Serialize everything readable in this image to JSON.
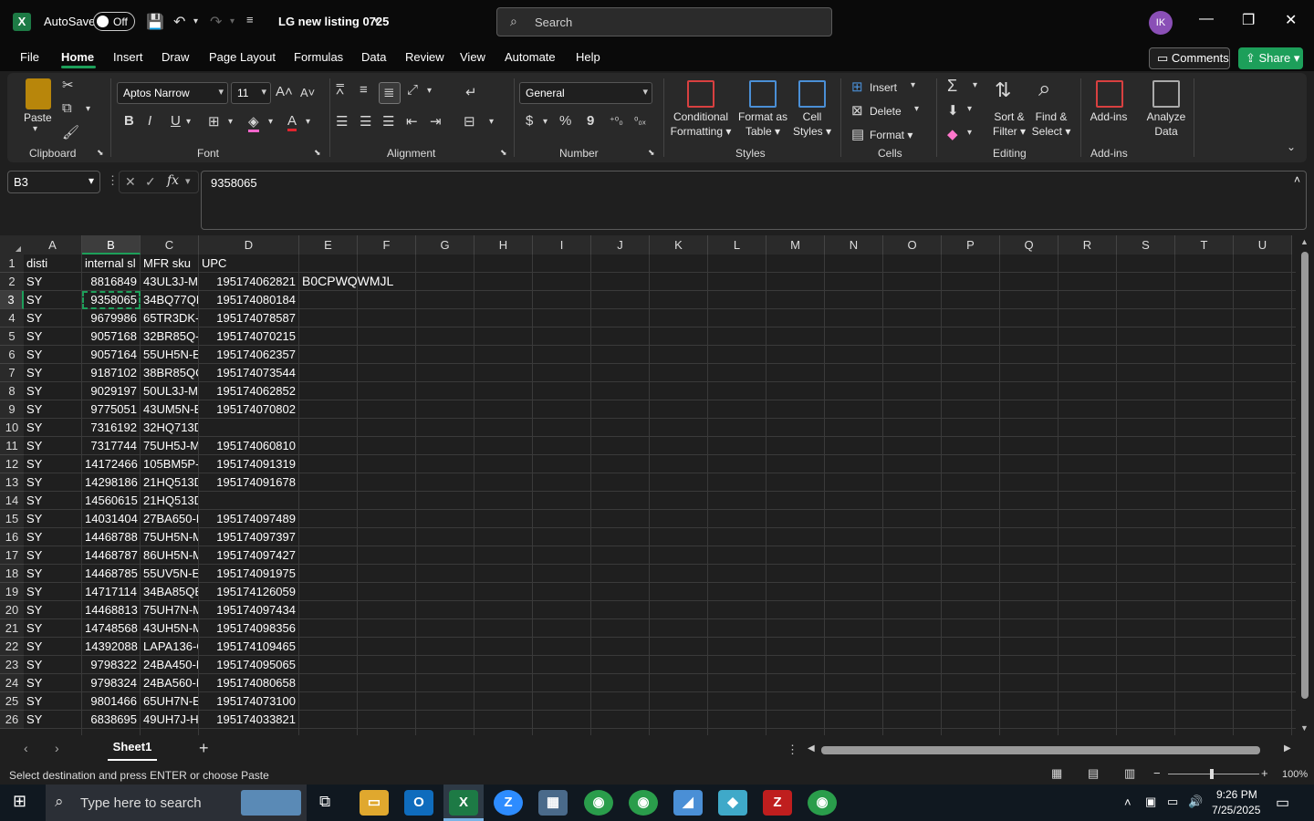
{
  "title_bar": {
    "autosave_label": "AutoSave",
    "autosave_state": "Off",
    "file_name": "LG new listing 0725",
    "search_placeholder": "Search",
    "user_initials": "IK"
  },
  "menu": {
    "items": [
      "File",
      "Home",
      "Insert",
      "Draw",
      "Page Layout",
      "Formulas",
      "Data",
      "Review",
      "View",
      "Automate",
      "Help"
    ],
    "active": "Home",
    "comments_label": "Comments",
    "share_label": "Share"
  },
  "ribbon": {
    "clipboard": {
      "paste": "Paste",
      "label": "Clipboard"
    },
    "font": {
      "name": "Aptos Narrow",
      "size": "11",
      "label": "Font",
      "bold": "B",
      "italic": "I",
      "underline": "U"
    },
    "alignment": {
      "label": "Alignment"
    },
    "number": {
      "format": "General",
      "label": "Number",
      "currency": "$",
      "percent": "%",
      "comma": "9"
    },
    "styles": {
      "conditional_1": "Conditional",
      "conditional_2": "Formatting",
      "format_table_1": "Format as",
      "format_table_2": "Table",
      "cell_styles_1": "Cell",
      "cell_styles_2": "Styles",
      "label": "Styles"
    },
    "cells": {
      "insert": "Insert",
      "delete": "Delete",
      "format": "Format",
      "label": "Cells"
    },
    "editing": {
      "sort_1": "Sort &",
      "sort_2": "Filter",
      "find_1": "Find &",
      "find_2": "Select",
      "label": "Editing"
    },
    "addins": {
      "addins": "Add-ins",
      "analyze_1": "Analyze",
      "analyze_2": "Data",
      "label": "Add-ins"
    }
  },
  "formula_bar": {
    "name_box": "B3",
    "formula": "9358065"
  },
  "sheet": {
    "columns": [
      "A",
      "B",
      "C",
      "D",
      "E",
      "F",
      "G",
      "H",
      "I",
      "J",
      "K",
      "L",
      "M",
      "N",
      "O",
      "P",
      "Q",
      "R",
      "S",
      "T",
      "U"
    ],
    "selected_column": "B",
    "selected_row": "3",
    "headers": {
      "A": "disti",
      "B": "internal sl",
      "C": "MFR sku",
      "D": "UPC"
    },
    "E2": "B0CPWQWMJL",
    "rows": [
      {
        "num": "2",
        "A": "SY",
        "B": "8816849",
        "C": "43UL3J-M",
        "D": "195174062821"
      },
      {
        "num": "3",
        "A": "SY",
        "B": "9358065",
        "C": "34BQ77QE",
        "D": "195174080184"
      },
      {
        "num": "4",
        "A": "SY",
        "B": "9679986",
        "C": "65TR3DK-E",
        "D": "195174078587"
      },
      {
        "num": "5",
        "A": "SY",
        "B": "9057168",
        "C": "32BR85Q-I",
        "D": "195174070215"
      },
      {
        "num": "6",
        "A": "SY",
        "B": "9057164",
        "C": "55UH5N-E",
        "D": "195174062357"
      },
      {
        "num": "7",
        "A": "SY",
        "B": "9187102",
        "C": "38BR85QC",
        "D": "195174073544"
      },
      {
        "num": "8",
        "A": "SY",
        "B": "9029197",
        "C": "50UL3J-M",
        "D": "195174062852"
      },
      {
        "num": "9",
        "A": "SY",
        "B": "9775051",
        "C": "43UM5N-E",
        "D": "195174070802"
      },
      {
        "num": "10",
        "A": "SY",
        "B": "7316192",
        "C": "32HQ713D",
        "D": ""
      },
      {
        "num": "11",
        "A": "SY",
        "B": "7317744",
        "C": "75UH5J-M",
        "D": "195174060810"
      },
      {
        "num": "12",
        "A": "SY",
        "B": "14172466",
        "C": "105BM5P-",
        "D": "195174091319"
      },
      {
        "num": "13",
        "A": "SY",
        "B": "14298186",
        "C": "21HQ513D",
        "D": "195174091678"
      },
      {
        "num": "14",
        "A": "SY",
        "B": "14560615",
        "C": "21HQ513D",
        "D": ""
      },
      {
        "num": "15",
        "A": "SY",
        "B": "14031404",
        "C": "27BA650-E",
        "D": "195174097489"
      },
      {
        "num": "16",
        "A": "SY",
        "B": "14468788",
        "C": "75UH5N-M",
        "D": "195174097397"
      },
      {
        "num": "17",
        "A": "SY",
        "B": "14468787",
        "C": "86UH5N-M",
        "D": "195174097427"
      },
      {
        "num": "18",
        "A": "SY",
        "B": "14468785",
        "C": "55UV5N-E",
        "D": "195174091975"
      },
      {
        "num": "19",
        "A": "SY",
        "B": "14717114",
        "C": "34BA85QE",
        "D": "195174126059"
      },
      {
        "num": "20",
        "A": "SY",
        "B": "14468813",
        "C": "75UH7N-M",
        "D": "195174097434"
      },
      {
        "num": "21",
        "A": "SY",
        "B": "14748568",
        "C": "43UH5N-M",
        "D": "195174098356"
      },
      {
        "num": "22",
        "A": "SY",
        "B": "14392088",
        "C": "LAPA136-C",
        "D": "195174109465"
      },
      {
        "num": "23",
        "A": "SY",
        "B": "9798322",
        "C": "24BA450-E",
        "D": "195174095065"
      },
      {
        "num": "24",
        "A": "SY",
        "B": "9798324",
        "C": "24BA560-E",
        "D": "195174080658"
      },
      {
        "num": "25",
        "A": "SY",
        "B": "9801466",
        "C": "65UH7N-E",
        "D": "195174073100"
      },
      {
        "num": "26",
        "A": "SY",
        "B": "6838695",
        "C": "49UH7J-H",
        "D": "195174033821"
      }
    ],
    "row1_num": "1",
    "sheet_tab": "Sheet1"
  },
  "status_bar": {
    "message": "Select destination and press ENTER or choose Paste",
    "zoom": "100%"
  },
  "taskbar": {
    "search_placeholder": "Type here to search",
    "time": "9:26 PM",
    "date": "7/25/2025"
  },
  "colors": {
    "accent": "#1d9f5a",
    "background": "#1f1f1f",
    "title": "#0a0a0a"
  }
}
